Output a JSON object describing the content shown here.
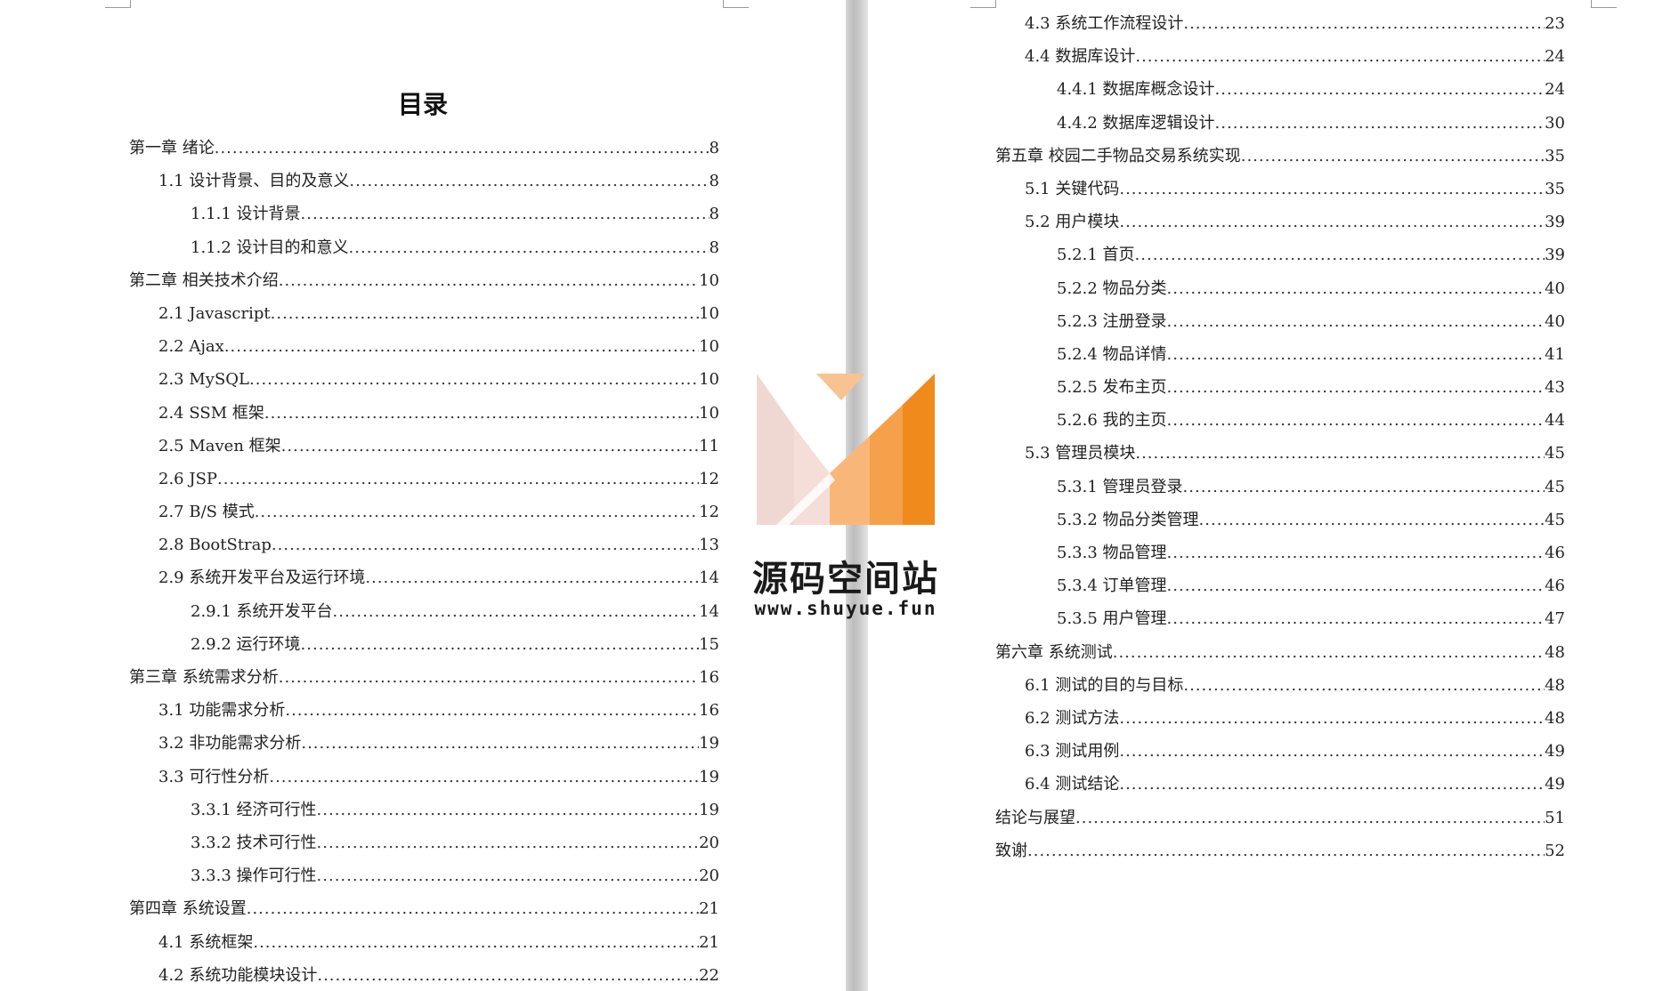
{
  "document": {
    "title": "目录",
    "left_page_entries": [
      {
        "label": "第一章 绪论",
        "page": "8",
        "level": 1
      },
      {
        "label": "1.1 设计背景、目的及意义",
        "page": "8",
        "level": 2
      },
      {
        "label": "1.1.1 设计背景",
        "page": "8",
        "level": 3
      },
      {
        "label": "1.1.2 设计目的和意义",
        "page": "8",
        "level": 3
      },
      {
        "label": "第二章  相关技术介绍",
        "page": "10",
        "level": 1
      },
      {
        "label": "2.1 Javascript",
        "page": "10",
        "level": 2
      },
      {
        "label": "2.2 Ajax",
        "page": "10",
        "level": 2
      },
      {
        "label": "2.3 MySQL",
        "page": "10",
        "level": 2
      },
      {
        "label": "2.4 SSM 框架",
        "page": "10",
        "level": 2
      },
      {
        "label": "2.5 Maven 框架",
        "page": "11",
        "level": 2
      },
      {
        "label": "2.6 JSP",
        "page": "12",
        "level": 2
      },
      {
        "label": "2.7 B/S 模式",
        "page": "12",
        "level": 2
      },
      {
        "label": "2.8 BootStrap",
        "page": "13",
        "level": 2
      },
      {
        "label": "2.9 系统开发平台及运行环境",
        "page": "14",
        "level": 2
      },
      {
        "label": "2.9.1 系统开发平台",
        "page": "14",
        "level": 3
      },
      {
        "label": "2.9.2 运行环境",
        "page": "15",
        "level": 3
      },
      {
        "label": "第三章 系统需求分析",
        "page": "16",
        "level": 1
      },
      {
        "label": "3.1 功能需求分析",
        "page": "16",
        "level": 2
      },
      {
        "label": "3.2 非功能需求分析",
        "page": "19",
        "level": 2
      },
      {
        "label": "3.3 可行性分析",
        "page": "19",
        "level": 2
      },
      {
        "label": "3.3.1 经济可行性",
        "page": "19",
        "level": 3
      },
      {
        "label": "3.3.2 技术可行性",
        "page": "20",
        "level": 3
      },
      {
        "label": "3.3.3 操作可行性",
        "page": "20",
        "level": 3
      },
      {
        "label": "第四章  系统设置",
        "page": "21",
        "level": 1
      },
      {
        "label": "4.1 系统框架",
        "page": "21",
        "level": 2
      },
      {
        "label": "4.2 系统功能模块设计",
        "page": "22",
        "level": 2
      }
    ],
    "right_page_entries": [
      {
        "label": "4.3 系统工作流程设计",
        "page": "23",
        "level": 2
      },
      {
        "label": "4.4 数据库设计",
        "page": "24",
        "level": 2
      },
      {
        "label": "4.4.1 数据库概念设计",
        "page": "24",
        "level": 3
      },
      {
        "label": "4.4.2 数据库逻辑设计",
        "page": "30",
        "level": 3
      },
      {
        "label": "第五章 校园二手物品交易系统实现",
        "page": "35",
        "level": 1
      },
      {
        "label": "5.1 关键代码",
        "page": "35",
        "level": 2
      },
      {
        "label": "5.2 用户模块",
        "page": "39",
        "level": 2
      },
      {
        "label": "5.2.1 首页",
        "page": "39",
        "level": 3
      },
      {
        "label": "5.2.2 物品分类",
        "page": "40",
        "level": 3
      },
      {
        "label": "5.2.3 注册登录",
        "page": "40",
        "level": 3
      },
      {
        "label": "5.2.4 物品详情",
        "page": "41",
        "level": 3
      },
      {
        "label": "5.2.5 发布主页",
        "page": "43",
        "level": 3
      },
      {
        "label": "5.2.6 我的主页",
        "page": "44",
        "level": 3
      },
      {
        "label": "5.3 管理员模块",
        "page": "45",
        "level": 2
      },
      {
        "label": "5.3.1 管理员登录",
        "page": "45",
        "level": 3
      },
      {
        "label": "5.3.2 物品分类管理",
        "page": "45",
        "level": 3
      },
      {
        "label": "5.3.3 物品管理",
        "page": "46",
        "level": 3
      },
      {
        "label": "5.3.4 订单管理",
        "page": "46",
        "level": 3
      },
      {
        "label": "5.3.5 用户管理",
        "page": "47",
        "level": 3
      },
      {
        "label": "第六章 系统测试",
        "page": "48",
        "level": 1
      },
      {
        "label": "6.1 测试的目的与目标",
        "page": "48",
        "level": 2
      },
      {
        "label": "6.2 测试方法",
        "page": "48",
        "level": 2
      },
      {
        "label": "6.3 测试用例",
        "page": "49",
        "level": 2
      },
      {
        "label": "6.4 测试结论",
        "page": "49",
        "level": 2
      },
      {
        "label": "结论与展望",
        "page": "51",
        "level": 1
      },
      {
        "label": "致谢",
        "page": "52",
        "level": 1
      }
    ]
  },
  "watermark": {
    "name": "源码空间站",
    "url": "www.shuyue.fun",
    "colors": {
      "light": "#f0d8d2",
      "orange_light": "#f8b779",
      "orange_mid": "#f5a04a",
      "orange_dark": "#f08a1c"
    }
  }
}
